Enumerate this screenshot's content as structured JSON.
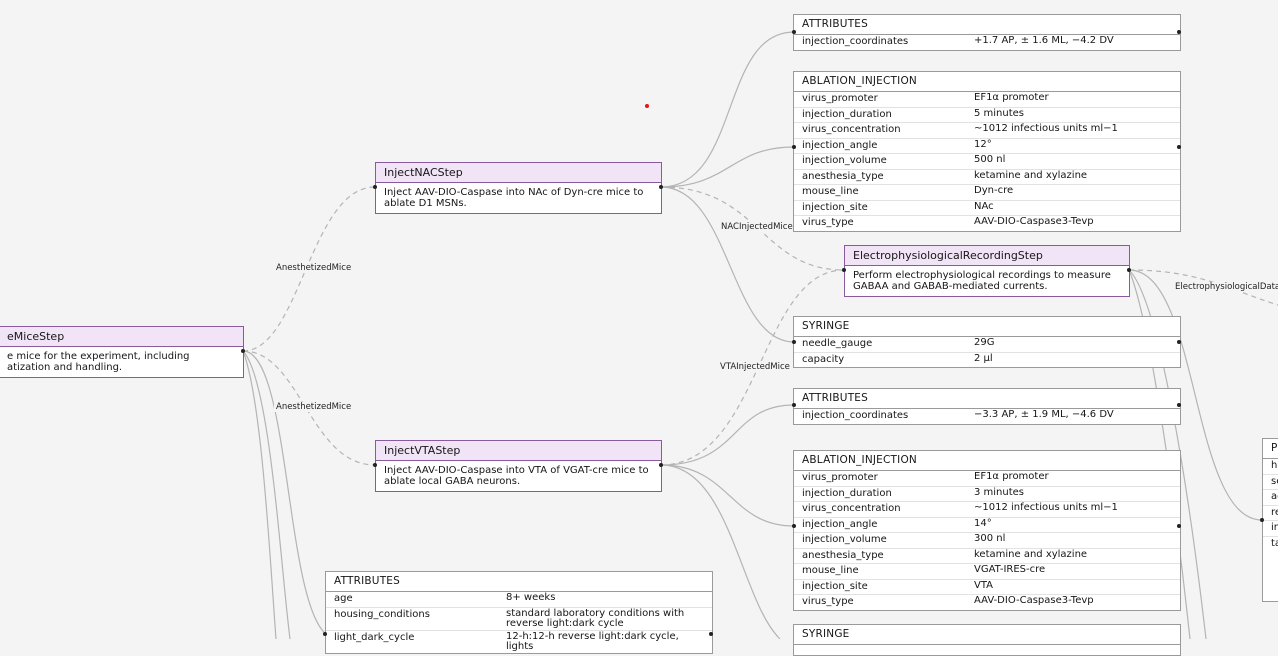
{
  "steps": {
    "prepare": {
      "title": "eMiceStep",
      "desc": "e mice for the experiment, including\natization and handling."
    },
    "nac": {
      "title": "InjectNACStep",
      "desc": "Inject AAV-DIO-Caspase into NAc of Dyn-cre mice to ablate D1 MSNs."
    },
    "vta": {
      "title": "InjectVTAStep",
      "desc": "Inject AAV-DIO-Caspase into VTA of VGAT-cre mice to ablate local GABA neurons."
    },
    "ephys": {
      "title": "ElectrophysiologicalRecordingStep",
      "desc": "Perform electrophysiological recordings to measure GABAA and GABAB-mediated currents."
    }
  },
  "edge_labels": {
    "anesthetized_top": "AnesthetizedMice",
    "anesthetized_bottom": "AnesthetizedMice",
    "nac_injected": "NACInjectedMice",
    "vta_injected": "VTAInjectedMice",
    "ephys_data": "ElectrophysiologicalData"
  },
  "tables": {
    "nac_attributes": {
      "title": "ATTRIBUTES",
      "rows": [
        [
          "injection_coordinates",
          "+1.7 AP, ± 1.6 ML, −4.2 DV"
        ]
      ]
    },
    "nac_ablation": {
      "title": "ABLATION_INJECTION",
      "rows": [
        [
          "virus_promoter",
          "EF1α promoter"
        ],
        [
          "injection_duration",
          "5 minutes"
        ],
        [
          "virus_concentration",
          "~1012 infectious units ml−1"
        ],
        [
          "injection_angle",
          "12°"
        ],
        [
          "injection_volume",
          "500 nl"
        ],
        [
          "anesthesia_type",
          "ketamine and xylazine"
        ],
        [
          "mouse_line",
          "Dyn-cre"
        ],
        [
          "injection_site",
          "NAc"
        ],
        [
          "virus_type",
          "AAV-DIO-Caspase3-Tevp"
        ]
      ]
    },
    "syringe1": {
      "title": "SYRINGE",
      "rows": [
        [
          "needle_gauge",
          "29G"
        ],
        [
          "capacity",
          "2 µl"
        ]
      ]
    },
    "vta_attributes": {
      "title": "ATTRIBUTES",
      "rows": [
        [
          "injection_coordinates",
          "−3.3 AP, ± 1.9 ML, −4.6 DV"
        ]
      ]
    },
    "vta_ablation": {
      "title": "ABLATION_INJECTION",
      "rows": [
        [
          "virus_promoter",
          "EF1α promoter"
        ],
        [
          "injection_duration",
          "3 minutes"
        ],
        [
          "virus_concentration",
          "~1012 infectious units ml−1"
        ],
        [
          "injection_angle",
          "14°"
        ],
        [
          "injection_volume",
          "300 nl"
        ],
        [
          "anesthesia_type",
          "ketamine and xylazine"
        ],
        [
          "mouse_line",
          "VGAT-IRES-cre"
        ],
        [
          "injection_site",
          "VTA"
        ],
        [
          "virus_type",
          "AAV-DIO-Caspase3-Tevp"
        ]
      ]
    },
    "syringe2": {
      "title": "SYRINGE",
      "rows": []
    },
    "mice_attributes": {
      "title": "ATTRIBUTES",
      "rows": [
        [
          "age",
          "8+ weeks"
        ],
        [
          "housing_conditions",
          "standard laboratory conditions with reverse light:dark cycle"
        ],
        [
          "light_dark_cycle",
          "12-h:12-h reverse light:dark cycle, lights"
        ]
      ]
    },
    "right_partial": {
      "title": "P",
      "rows": [
        [
          "he",
          ""
        ],
        [
          "se",
          ""
        ],
        [
          "ac",
          ""
        ],
        [
          "re",
          ""
        ],
        [
          "in",
          ""
        ],
        [
          "ta",
          ""
        ]
      ]
    }
  }
}
